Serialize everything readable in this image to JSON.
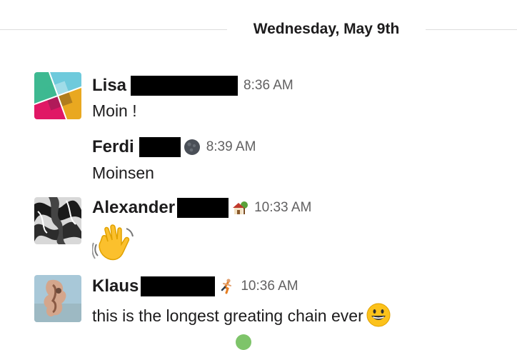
{
  "divider": {
    "date": "Wednesday, May 9th"
  },
  "messages": [
    {
      "author": "Lisa",
      "time": "8:36 AM",
      "text": "Moin !",
      "avatar": "slack-logo-avatar",
      "status_icon": null
    },
    {
      "author": "Ferdi",
      "time": "8:39 AM",
      "text": "Moinsen",
      "avatar": null,
      "status_icon": "new-moon-icon"
    },
    {
      "author": "Alexander",
      "time": "10:33 AM",
      "text": "",
      "avatar": "abstract-bw-avatar",
      "status_icon": "house-with-garden-icon",
      "emoji_message": "waving-hand-icon"
    },
    {
      "author": "Klaus",
      "time": "10:36 AM",
      "text": "this is the longest greating chain ever",
      "avatar": "photo-avatar",
      "status_icon": "runner-icon",
      "trailing_emoji": "grinning-face-icon"
    }
  ],
  "colors": {
    "text": "#1d1c1d",
    "timestamp": "#616061",
    "divider_line": "#dddddd",
    "redaction": "#000000"
  }
}
